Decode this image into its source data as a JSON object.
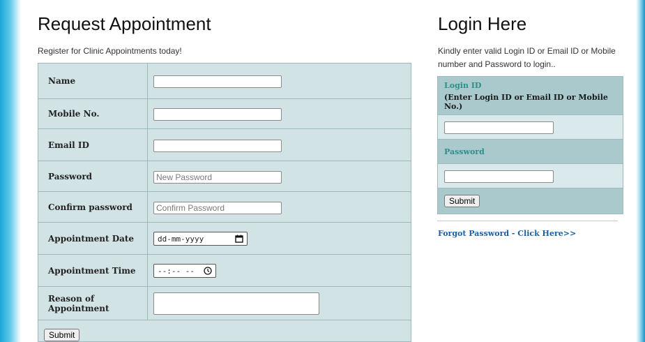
{
  "appointment": {
    "title": "Request Appointment",
    "subtitle": "Register for Clinic Appointments today!",
    "fields": {
      "name_label": "Name",
      "mobile_label": "Mobile No.",
      "email_label": "Email ID",
      "password_label": "Password",
      "password_placeholder": "New Password",
      "confirm_label": "Confirm password",
      "confirm_placeholder": "Confirm Password",
      "date_label": "Appointment Date",
      "date_value": "dd-mm-yyyy",
      "time_label": "Appointment Time",
      "time_value": "--:-- --",
      "reason_label": "Reason of Appointment"
    },
    "submit_label": "Submit"
  },
  "login": {
    "title": "Login Here",
    "description": "Kindly enter valid Login ID or Email ID or Mobile number and Password to login..",
    "login_id_label": "Login ID",
    "login_id_hint": "(Enter Login ID or Email ID or Mobile No.)",
    "password_label": "Password",
    "submit_label": "Submit",
    "forgot_link": "Forgot Password - Click Here>>"
  },
  "colors": {
    "table_bg": "#d2e3e6",
    "header_bg": "#a9c9cd",
    "teal_label": "#2e8e8a",
    "link": "#1d5fa8",
    "side_gradient": "#1aa7d6"
  }
}
